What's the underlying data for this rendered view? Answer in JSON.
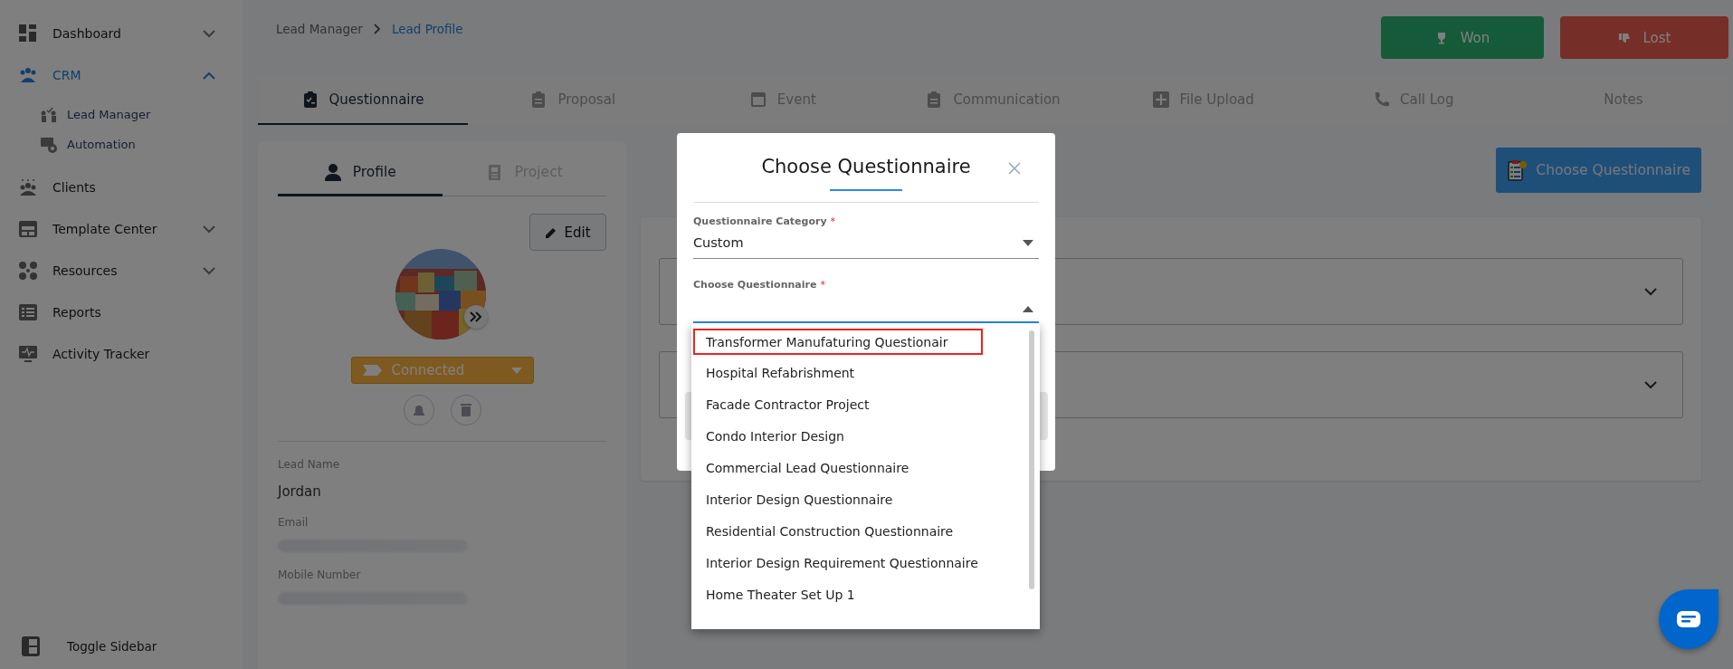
{
  "sidebar": {
    "items": [
      {
        "label": "Dashboard",
        "kind": "group",
        "expanded": false,
        "selected": false
      },
      {
        "label": "CRM",
        "kind": "group",
        "expanded": true,
        "selected": true,
        "children": [
          {
            "label": "Lead Manager",
            "selected": false
          },
          {
            "label": "Automation",
            "selected": false
          }
        ]
      },
      {
        "label": "Clients",
        "kind": "link",
        "selected": false
      },
      {
        "label": "Template Center",
        "kind": "group",
        "expanded": false,
        "selected": false
      },
      {
        "label": "Resources",
        "kind": "group",
        "expanded": false,
        "selected": false
      },
      {
        "label": "Reports",
        "kind": "link",
        "selected": false
      },
      {
        "label": "Activity Tracker",
        "kind": "link",
        "selected": false
      }
    ],
    "toggle": "Toggle Sidebar"
  },
  "breadcrumb": [
    {
      "label": "Lead Manager",
      "current": false
    },
    {
      "label": "Lead Profile",
      "current": true
    }
  ],
  "actions": [
    {
      "label": "Won",
      "kind": "won"
    },
    {
      "label": "Lost",
      "kind": "lost"
    }
  ],
  "tabs": [
    {
      "label": "Questionnaire",
      "selected": true
    },
    {
      "label": "Proposal",
      "selected": false
    },
    {
      "label": "Event",
      "selected": false
    },
    {
      "label": "Communication",
      "selected": false
    },
    {
      "label": "File Upload",
      "selected": false
    },
    {
      "label": "Call Log",
      "selected": false
    },
    {
      "label": "Notes",
      "selected": false
    }
  ],
  "profile_panel": {
    "tabs": [
      {
        "label": "Profile",
        "selected": true
      },
      {
        "label": "Project",
        "selected": false
      }
    ],
    "edit_button": "Edit",
    "status": "Connected",
    "fields": [
      {
        "label": "Lead Name",
        "value": "Jordan",
        "redacted": false
      },
      {
        "label": "Email",
        "redacted": true
      },
      {
        "label": "Mobile Number",
        "redacted": true
      }
    ]
  },
  "main": {
    "choose_button": "Choose Questionnaire",
    "accordions": [
      {
        "expanded": false
      },
      {
        "expanded": false
      }
    ]
  },
  "modal": {
    "title": "Choose Questionnaire",
    "fields": [
      {
        "label": "Questionnaire Category",
        "required_mark": "*",
        "value": "Custom",
        "open": false
      },
      {
        "label": "Choose Questionnaire",
        "required_mark": "*",
        "open": true
      }
    ],
    "options": [
      {
        "label": "Transformer Manufaturing Questionair",
        "highlighted": true
      },
      {
        "label": "Hospital Refabrishment",
        "highlighted": false
      },
      {
        "label": "Facade Contractor Project",
        "highlighted": false
      },
      {
        "label": "Condo Interior Design",
        "highlighted": false
      },
      {
        "label": "Commercial Lead Questionnaire",
        "highlighted": false
      },
      {
        "label": "Interior Design Questionnaire",
        "highlighted": false
      },
      {
        "label": "Residential Construction Questionnaire",
        "highlighted": false
      },
      {
        "label": "Interior Design Requirement Questionnaire",
        "highlighted": false
      },
      {
        "label": "Home Theater Set Up 1",
        "highlighted": false
      }
    ]
  }
}
